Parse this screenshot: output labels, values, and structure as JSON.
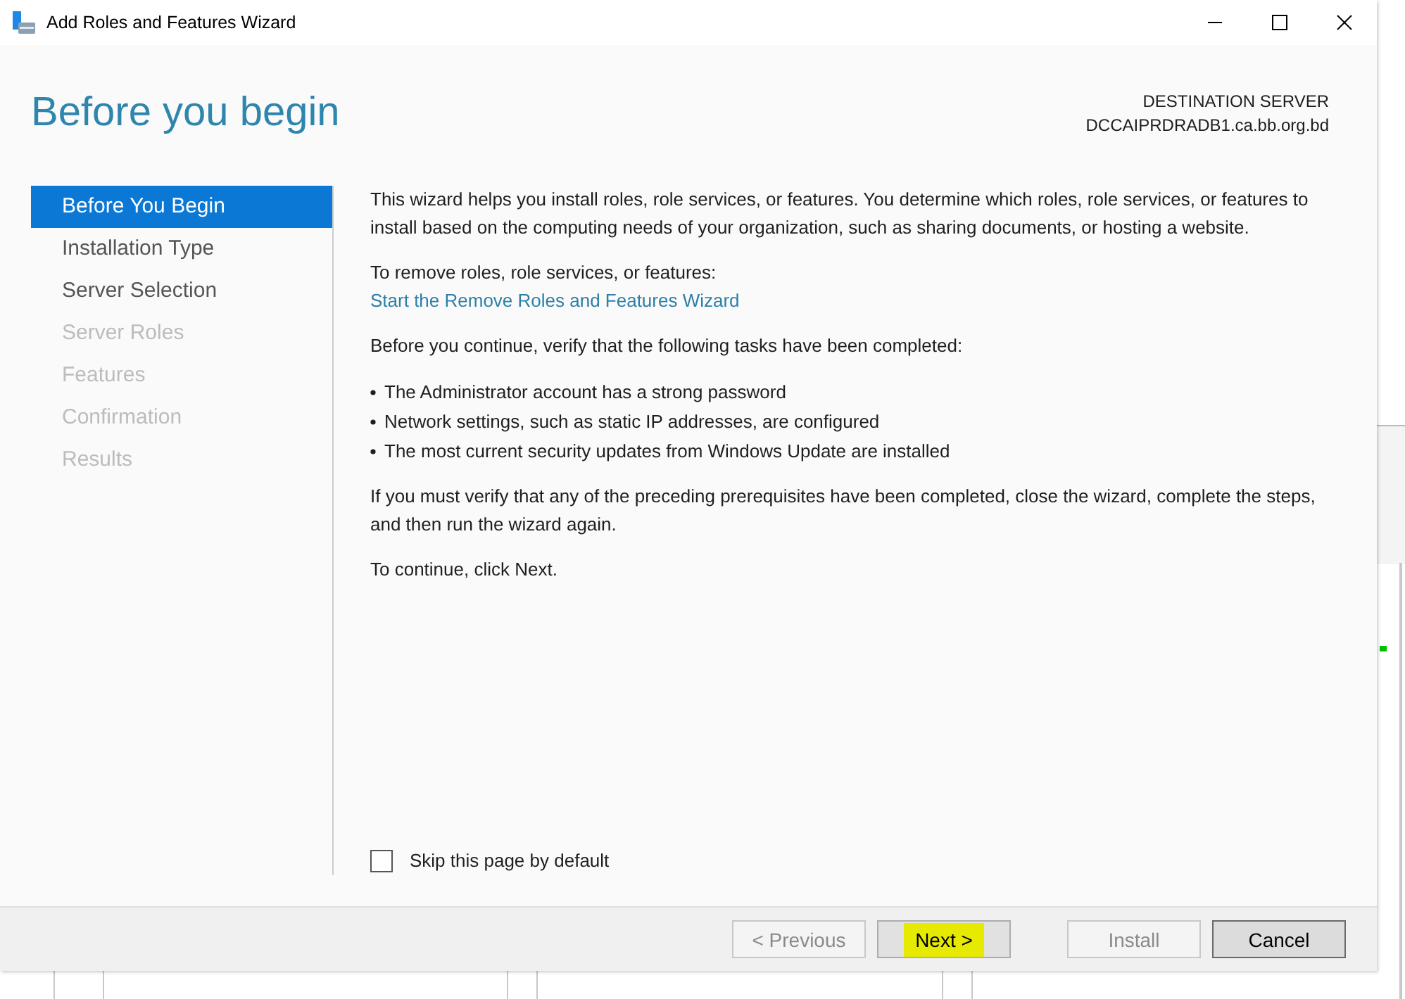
{
  "window": {
    "title": "Add Roles and Features Wizard"
  },
  "header": {
    "title": "Before you begin",
    "destination_label": "DESTINATION SERVER",
    "destination_server": "DCCAIPRDRADB1.ca.bb.org.bd"
  },
  "steps": [
    {
      "label": "Before You Begin",
      "selected": true,
      "disabled": false
    },
    {
      "label": "Installation Type",
      "selected": false,
      "disabled": false
    },
    {
      "label": "Server Selection",
      "selected": false,
      "disabled": false
    },
    {
      "label": "Server Roles",
      "selected": false,
      "disabled": true
    },
    {
      "label": "Features",
      "selected": false,
      "disabled": true
    },
    {
      "label": "Confirmation",
      "selected": false,
      "disabled": true
    },
    {
      "label": "Results",
      "selected": false,
      "disabled": true
    }
  ],
  "content": {
    "intro": "This wizard helps you install roles, role services, or features. You determine which roles, role services, or features to install based on the computing needs of your organization, such as sharing documents, or hosting a website.",
    "remove_label": "To remove roles, role services, or features:",
    "remove_link": "Start the Remove Roles and Features Wizard",
    "verify_text": "Before you continue, verify that the following tasks have been completed:",
    "bullets": [
      "The Administrator account has a strong password",
      "Network settings, such as static IP addresses, are configured",
      "The most current security updates from Windows Update are installed"
    ],
    "prereq_text": "If you must verify that any of the preceding prerequisites have been completed, close the wizard, complete the steps, and then run the wizard again.",
    "continue_text": "To continue, click Next."
  },
  "skip_checkbox": {
    "label": "Skip this page by default",
    "checked": false
  },
  "buttons": [
    {
      "label": "< Previous",
      "disabled": true,
      "highlighted": false,
      "default": false
    },
    {
      "label": "Next >",
      "disabled": false,
      "highlighted": true,
      "default": false
    },
    {
      "label": "Install",
      "disabled": true,
      "highlighted": false,
      "default": false
    },
    {
      "label": "Cancel",
      "disabled": false,
      "highlighted": false,
      "default": true
    }
  ]
}
